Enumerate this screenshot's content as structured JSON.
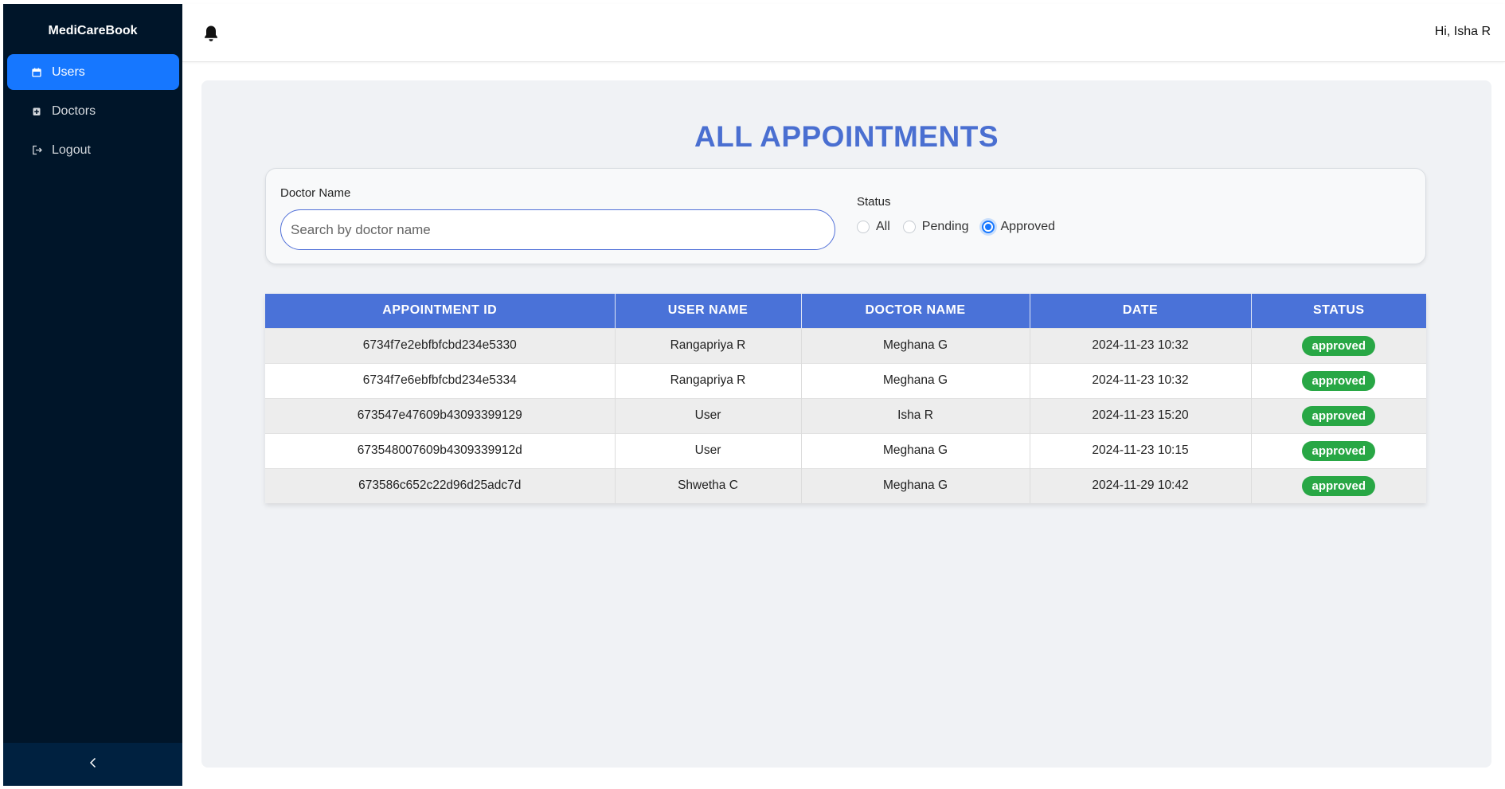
{
  "app": {
    "brand": "MediCareBook"
  },
  "sidebar": {
    "items": [
      {
        "label": "Users",
        "icon": "calendar-icon",
        "active": true
      },
      {
        "label": "Doctors",
        "icon": "medical-kit-icon",
        "active": false
      },
      {
        "label": "Logout",
        "icon": "logout-icon",
        "active": false
      }
    ],
    "collapse_icon": "chevron-left-icon"
  },
  "header": {
    "greeting": "Hi, Isha R",
    "notification_icon": "bell-icon"
  },
  "main": {
    "title": "ALL APPOINTMENTS",
    "filters": {
      "doctor_name_label": "Doctor Name",
      "search_placeholder": "Search by doctor name",
      "search_value": "",
      "status_label": "Status",
      "status_options": [
        "All",
        "Pending",
        "Approved"
      ],
      "status_selected": "Approved"
    },
    "table": {
      "headers": [
        "APPOINTMENT ID",
        "USER NAME",
        "DOCTOR NAME",
        "DATE",
        "STATUS"
      ],
      "rows": [
        [
          "6734f7e2ebfbfcbd234e5330",
          "Rangapriya R",
          "Meghana G",
          "2024-11-23 10:32",
          "approved"
        ],
        [
          "6734f7e6ebfbfcbd234e5334",
          "Rangapriya R",
          "Meghana G",
          "2024-11-23 10:32",
          "approved"
        ],
        [
          "673547e47609b43093399129",
          "User",
          "Isha R",
          "2024-11-23 15:20",
          "approved"
        ],
        [
          "673548007609b4309339912d",
          "User",
          "Meghana G",
          "2024-11-23 10:15",
          "approved"
        ],
        [
          "673586c652c22d96d25adc7d",
          "Shwetha C",
          "Meghana G",
          "2024-11-29 10:42",
          "approved"
        ]
      ]
    }
  },
  "colors": {
    "sidebar_bg": "#001529",
    "active_item": "#1677ff",
    "title": "#4a6fd1",
    "table_header": "#4a72d8",
    "approved_badge": "#28a745"
  }
}
